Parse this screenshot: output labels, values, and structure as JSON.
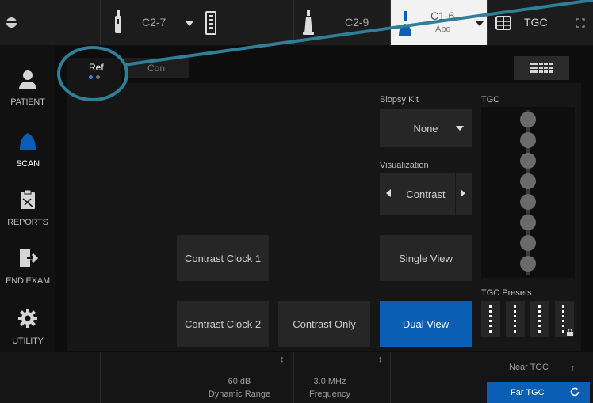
{
  "probes": [
    {
      "name": "C2-7"
    },
    {
      "name": "C2-9"
    },
    {
      "name": "C1-6",
      "preset": "Abd"
    }
  ],
  "topbar": {
    "tgc_label": "TGC"
  },
  "sidebar": {
    "items": [
      {
        "label": "PATIENT"
      },
      {
        "label": "SCAN"
      },
      {
        "label": "REPORTS"
      },
      {
        "label": "END EXAM"
      },
      {
        "label": "UTILITY"
      }
    ]
  },
  "tabs": [
    {
      "label": "Ref"
    },
    {
      "label": "Con"
    }
  ],
  "controls": {
    "biopsy_kit_label": "Biopsy Kit",
    "biopsy_kit_value": "None",
    "visualization_label": "Visualization",
    "visualization_value": "Contrast",
    "tgc_label": "TGC",
    "tgc_presets_label": "TGC Presets",
    "buttons": {
      "contrast_clock_1": "Contrast Clock 1",
      "contrast_clock_2": "Contrast Clock 2",
      "contrast_only": "Contrast Only",
      "single_view": "Single View",
      "dual_view": "Dual View"
    }
  },
  "bottom": {
    "dynamic_range_value": "60 dB",
    "dynamic_range_label": "Dynamic Range",
    "frequency_value": "3.0 MHz",
    "frequency_label": "Frequency",
    "near_tgc": "Near TGC",
    "far_tgc": "Far TGC"
  },
  "colors": {
    "accent_blue": "#0a5fb4",
    "annotation_teal": "#2f7f98"
  }
}
